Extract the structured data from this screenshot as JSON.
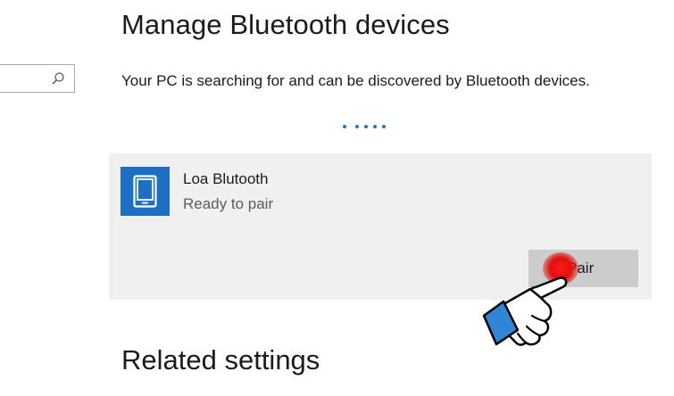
{
  "page": {
    "title": "Manage Bluetooth devices",
    "status_text": "Your PC is searching for and can be discovered by Bluetooth devices."
  },
  "search": {
    "icon": "search-icon",
    "value": ""
  },
  "progress": {
    "type": "indeterminate-dots"
  },
  "device": {
    "name": "Loa Blutooth",
    "status": "Ready to pair",
    "icon": "phone-icon",
    "pair_label": "Pair"
  },
  "related": {
    "heading": "Related settings"
  },
  "colors": {
    "accent": "#1d6fc4",
    "card_background": "#f0f0f0",
    "button_background": "#cccccc",
    "highlight": "#e01010"
  }
}
